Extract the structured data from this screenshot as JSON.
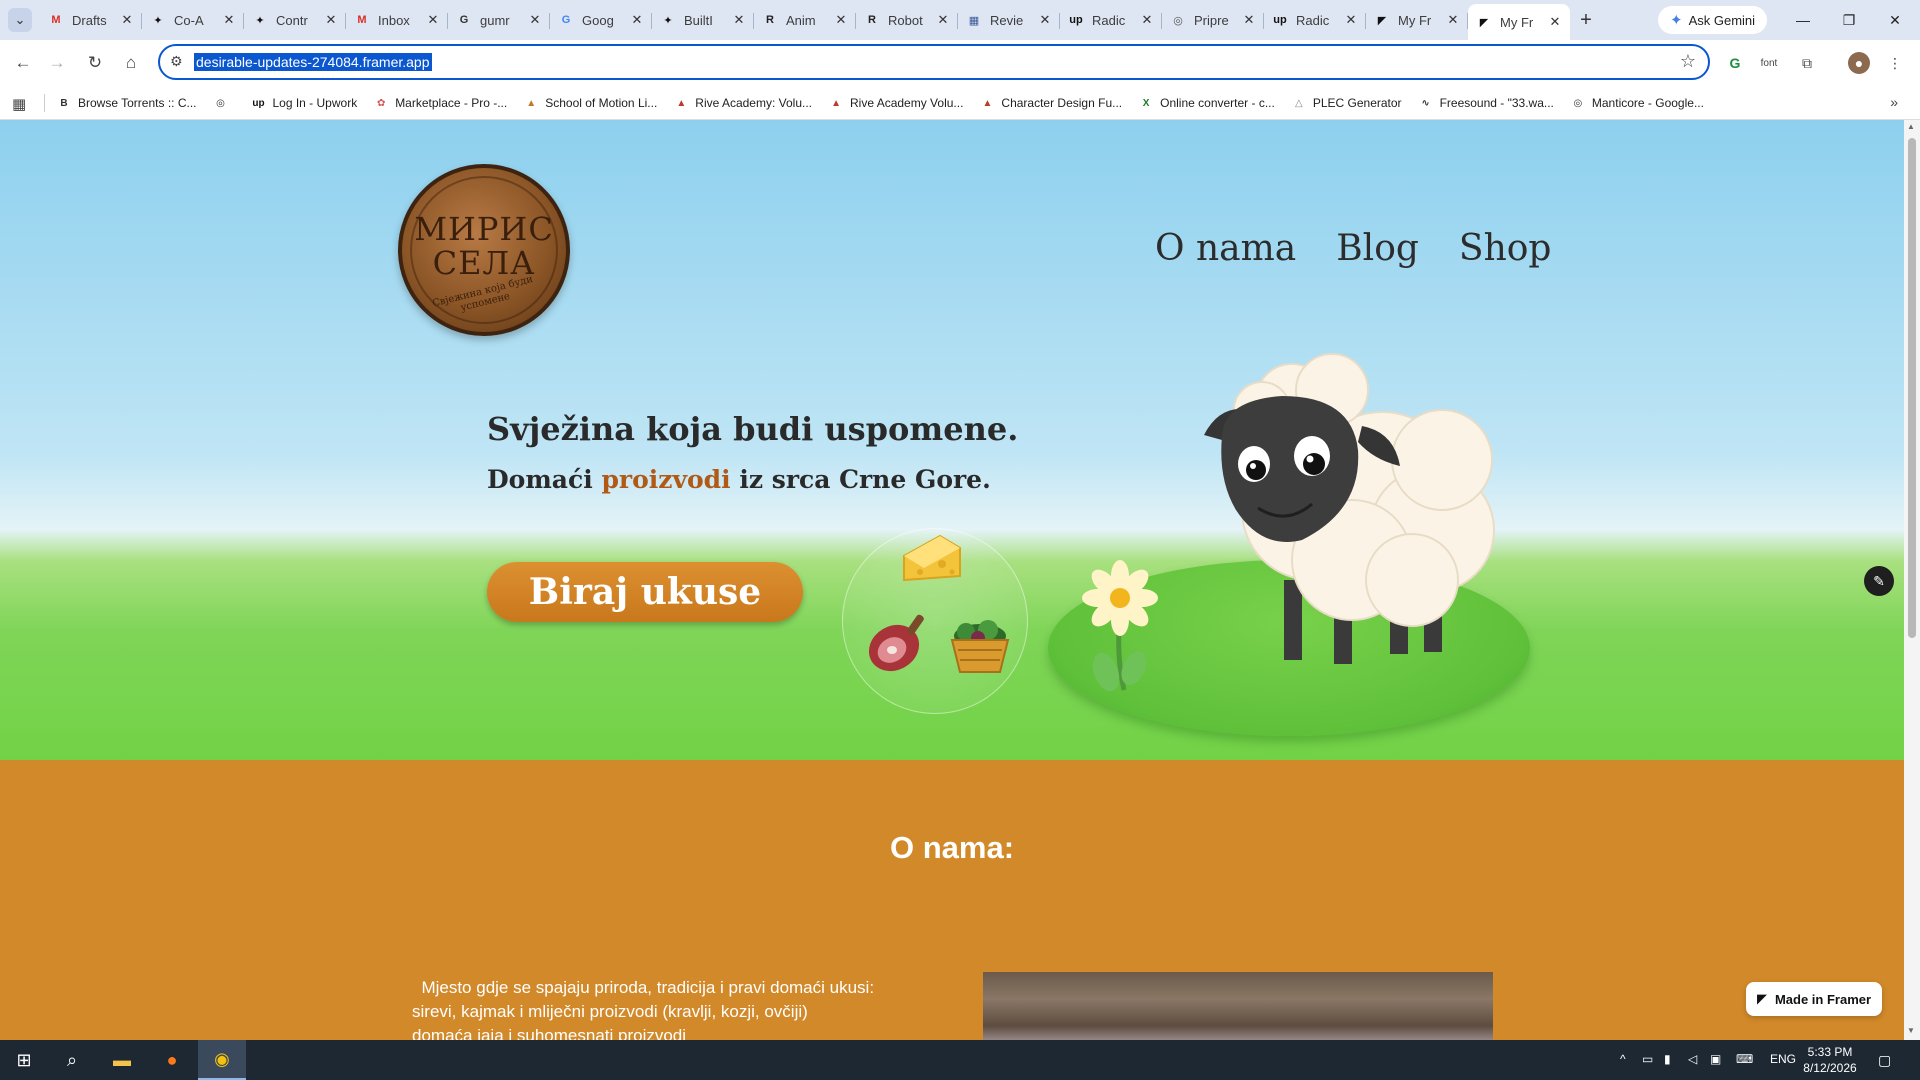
{
  "browser": {
    "tabs": [
      {
        "title": "Drafts",
        "icon": "gmail-icon",
        "glyph": "M",
        "color": "#d93025"
      },
      {
        "title": "Co-A",
        "icon": "openai-icon",
        "glyph": "✦",
        "color": "#111111"
      },
      {
        "title": "Contr",
        "icon": "openai-icon",
        "glyph": "✦",
        "color": "#111111"
      },
      {
        "title": "Inbox",
        "icon": "gmail-icon",
        "glyph": "M",
        "color": "#d93025"
      },
      {
        "title": "gumr",
        "icon": "gumroad-icon",
        "glyph": "G",
        "color": "#333333"
      },
      {
        "title": "Goog",
        "icon": "google-translate-icon",
        "glyph": "G",
        "color": "#4285f4"
      },
      {
        "title": "BuiltI",
        "icon": "openai-icon",
        "glyph": "✦",
        "color": "#111111"
      },
      {
        "title": "Anim",
        "icon": "rive-icon",
        "glyph": "R",
        "color": "#222222"
      },
      {
        "title": "Robot",
        "icon": "rive-icon",
        "glyph": "R",
        "color": "#222222"
      },
      {
        "title": "Revie",
        "icon": "review-icon",
        "glyph": "▦",
        "color": "#3b5a9a"
      },
      {
        "title": "Radic",
        "icon": "upwork-icon",
        "glyph": "up",
        "color": "#111111"
      },
      {
        "title": "Pripre",
        "icon": "globe-icon",
        "glyph": "◎",
        "color": "#555555"
      },
      {
        "title": "Radic",
        "icon": "upwork-icon",
        "glyph": "up",
        "color": "#111111"
      },
      {
        "title": "My Fr",
        "icon": "framer-icon",
        "glyph": "◤",
        "color": "#111111"
      },
      {
        "title": "My Fr",
        "icon": "framer-icon",
        "glyph": "◤",
        "color": "#111111",
        "active": true
      }
    ],
    "new_tab": "+",
    "gemini_label": "Ask Gemini",
    "url": "desirable-updates-274084.framer.app",
    "toolbar_extra": "font",
    "bookmarks": [
      {
        "label": "Browse Torrents :: C...",
        "icon": "torrent-icon",
        "glyph": "B",
        "color": "#333333"
      },
      {
        "label": "",
        "icon": "globe-icon",
        "glyph": "◎",
        "color": "#333333"
      },
      {
        "label": "Log In - Upwork",
        "icon": "upwork-icon",
        "glyph": "up",
        "color": "#111111"
      },
      {
        "label": "Marketplace - Pro -...",
        "icon": "marketplace-icon",
        "glyph": "✿",
        "color": "#d9534f"
      },
      {
        "label": "School of Motion Li...",
        "icon": "school-of-motion-icon",
        "glyph": "▲",
        "color": "#c07a2a"
      },
      {
        "label": "Rive Academy: Volu...",
        "icon": "rive-academy-icon",
        "glyph": "▲",
        "color": "#c0392b"
      },
      {
        "label": "Rive Academy Volu...",
        "icon": "rive-academy-icon",
        "glyph": "▲",
        "color": "#c0392b"
      },
      {
        "label": "Character Design Fu...",
        "icon": "rive-academy-icon",
        "glyph": "▲",
        "color": "#c0392b"
      },
      {
        "label": "Online converter - c...",
        "icon": "converter-icon",
        "glyph": "X",
        "color": "#1d7a2a"
      },
      {
        "label": "PLEC Generator",
        "icon": "plec-icon",
        "glyph": "△",
        "color": "#888888"
      },
      {
        "label": "Freesound - \"33.wa...",
        "icon": "freesound-icon",
        "glyph": "∿",
        "color": "#333333"
      },
      {
        "label": "Manticore - Google...",
        "icon": "globe-icon",
        "glyph": "◎",
        "color": "#333333"
      }
    ]
  },
  "page": {
    "logo": {
      "title_line1": "МИРИС",
      "title_line2": "СЕЛА",
      "tagline": "Свјежина која буди успомене"
    },
    "nav": [
      "O nama",
      "Blog",
      "Shop"
    ],
    "headline": "Svježina koja budi uspomene.",
    "subline_before": "Domaći ",
    "subline_accent": "proizvodi",
    "subline_after": " iz srca Crne Gore.",
    "cta_label": "Biraj ukuse",
    "about_title": "O nama:",
    "about_lines": [
      "  Mjesto gdje se spajaju priroda, tradicija i pravi domaći ukusi:",
      "sirevi, kajmak i mliječni proizvodi (kravlji, kozji, ovčiji)",
      "domaća jaja i suhomesnati proizvodi"
    ],
    "framer_badge": "Made in Framer",
    "colors": {
      "accent": "#b05a16",
      "button": "#d2892a",
      "about_bg": "#d2892a",
      "grass": "#72d246",
      "sky": "#8dd0ee"
    }
  },
  "taskbar": {
    "lang": "ENG",
    "time": "5:33 PM",
    "date": "8/12/2026"
  }
}
